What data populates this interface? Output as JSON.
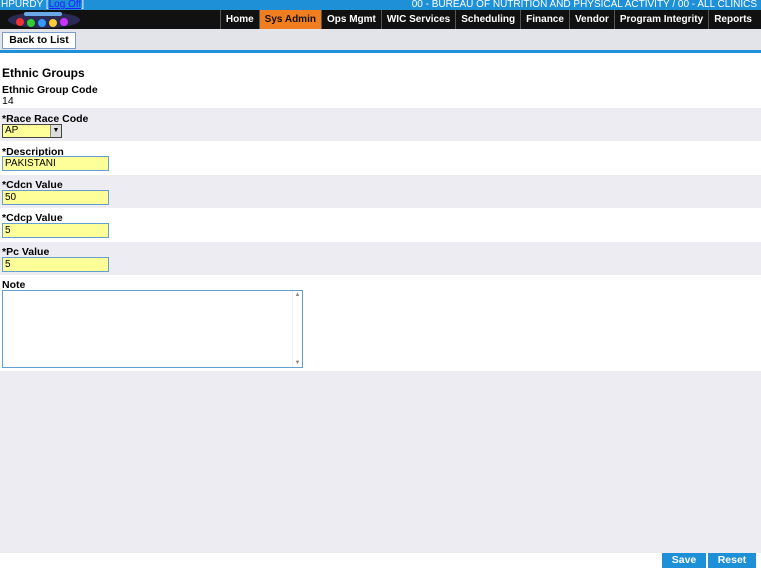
{
  "status": {
    "user": "HPURDY",
    "logoff_label": "Log Off",
    "org": "00 - BUREAU OF NUTRITION AND PHYSICAL ACTIVITY / 00 - ALL CLINICS"
  },
  "nav": {
    "tabs": [
      {
        "label": "Home"
      },
      {
        "label": "Sys Admin"
      },
      {
        "label": "Ops Mgmt"
      },
      {
        "label": "WIC Services"
      },
      {
        "label": "Scheduling"
      },
      {
        "label": "Finance"
      },
      {
        "label": "Vendor"
      },
      {
        "label": "Program Integrity"
      },
      {
        "label": "Reports"
      }
    ],
    "active": "Sys Admin"
  },
  "toolbar": {
    "back_label": "Back to List"
  },
  "page": {
    "title": "Ethnic Groups"
  },
  "form": {
    "ethnic_group_code": {
      "label": "Ethnic Group Code",
      "value": "14"
    },
    "race_code": {
      "label": "*Race Race Code",
      "value": "AP"
    },
    "description": {
      "label": "*Description",
      "value": "PAKISTANI"
    },
    "cdcn": {
      "label": "*Cdcn Value",
      "value": "50"
    },
    "cdcp": {
      "label": "*Cdcp Value",
      "value": "5"
    },
    "pc": {
      "label": "*Pc Value",
      "value": "5"
    },
    "note": {
      "label": "Note",
      "value": ""
    }
  },
  "footer": {
    "save_label": "Save",
    "reset_label": "Reset"
  },
  "colors": {
    "accent_blue": "#1e90d8",
    "active_tab": "#f07d1e",
    "field_yellow": "#ffff99"
  }
}
